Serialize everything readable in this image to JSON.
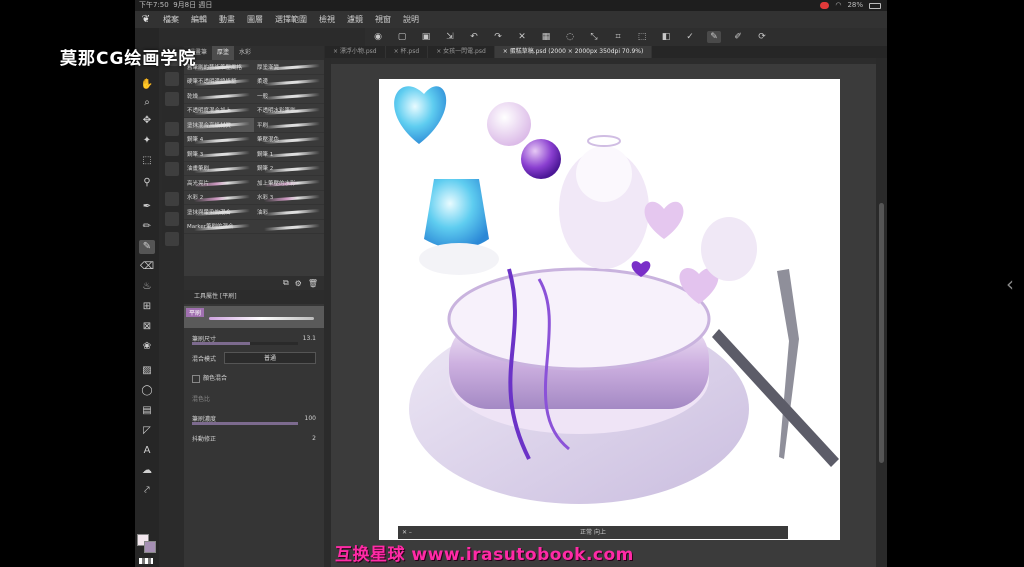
{
  "watermark_top": "莫那CG绘画学院",
  "watermark_bottom": "互换星球 www.irasutobook.com",
  "status": {
    "time": "下午7:50",
    "date": "9月8日 週日",
    "battery": "28%"
  },
  "menu": {
    "items": [
      "檔案",
      "編輯",
      "動畫",
      "圖層",
      "選擇範圍",
      "檢視",
      "濾鏡",
      "視窗",
      "說明"
    ]
  },
  "tabs": [
    {
      "label": "× 漂浮小物.psd",
      "active": false
    },
    {
      "label": "× 杯.psd",
      "active": false
    },
    {
      "label": "× 女孩一閃電.psd",
      "active": false
    },
    {
      "label": "× 蛋糕草稿.psd (2000 × 2000px 350dpi 70.9%)",
      "active": true
    }
  ],
  "brush_panel": {
    "tabs": [
      "漫畫筆",
      "厚塗",
      "水彩"
    ],
    "rows": [
      [
        "舊筆刷的藝術筆壓風格",
        "厚塗漸變"
      ],
      [
        "硬筆不透明邊線修整",
        "柔邊"
      ],
      [
        "乾燥",
        "一般"
      ],
      [
        "不透明度混合加上",
        "不透明水彩筆刷"
      ],
      [
        "塗抹混合高級材質",
        "平刷"
      ],
      [
        "鋼筆 4",
        "筆壓混色"
      ],
      [
        "鋼筆 3",
        "鋼筆 1"
      ],
      [
        "油畫筆刷",
        "鋼筆 2"
      ],
      [
        "高光亮片",
        "加上筆壓的水彩"
      ],
      [
        "水彩 2",
        "水彩 3"
      ],
      [
        "塗抹與暈染的混合",
        "油彩"
      ],
      [
        "Marker筆刷的混合",
        ""
      ]
    ]
  },
  "tool_props": {
    "title": "工具屬性 [平刷]",
    "preview_name": "平刷",
    "brush_size_label": "筆刷尺寸",
    "brush_size_value": "13.1",
    "brush_size_fraction": 0.55,
    "blend_label": "混合模式",
    "blend_value": "普通",
    "color_mix_label": "顏色混合",
    "color_mix_sub": "混色比",
    "opacity_label": "筆刷濃度",
    "opacity_value": "100",
    "opacity_fraction": 1.0,
    "stabilizer_label": "抖動修正",
    "stabilizer_value": "2"
  },
  "nav_strip": "正常 向上",
  "colors": {
    "accent_pink": "#ff2aa6",
    "foreground": "#f3e7ee",
    "background": "#a58fb3"
  }
}
